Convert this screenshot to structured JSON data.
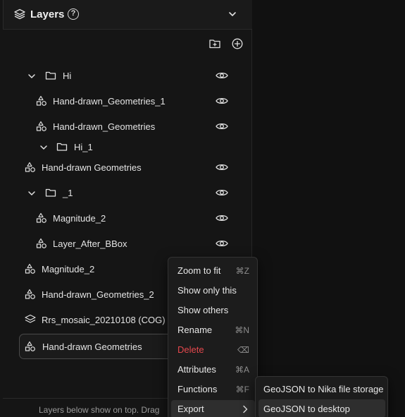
{
  "panel": {
    "title": "Layers",
    "help_icon": "?",
    "footer_text": "Layers below show on top. Drag"
  },
  "layers": [
    {
      "label": "Hi",
      "kind": "folder",
      "expanded": true,
      "visible": true
    },
    {
      "label": "Hand-drawn_Geometries_1",
      "kind": "geometry",
      "visible": true
    },
    {
      "label": "Hand-drawn_Geometries",
      "kind": "geometry",
      "visible": true
    },
    {
      "label": "Hi_1",
      "kind": "folder",
      "expanded": true
    },
    {
      "label": "Hand-drawn Geometries",
      "kind": "geometry",
      "visible": true
    },
    {
      "label": "_1",
      "kind": "folder",
      "expanded": true,
      "visible": true
    },
    {
      "label": "Magnitude_2",
      "kind": "geometry",
      "visible": true
    },
    {
      "label": "Layer_After_BBox",
      "kind": "geometry",
      "visible": true
    },
    {
      "label": "Magnitude_2",
      "kind": "geometry"
    },
    {
      "label": "Hand-drawn_Geometries_2",
      "kind": "geometry"
    },
    {
      "label": "Rrs_mosaic_20210108 (COG)",
      "kind": "raster"
    },
    {
      "label": "Hand-drawn Geometries",
      "kind": "geometry",
      "selected": true
    }
  ],
  "context_menu": {
    "items": [
      {
        "label": "Zoom to fit",
        "shortcut": "⌘Z"
      },
      {
        "label": "Show only this",
        "shortcut": ""
      },
      {
        "label": "Show others",
        "shortcut": ""
      },
      {
        "label": "Rename",
        "shortcut": "⌘N"
      },
      {
        "label": "Delete",
        "shortcut": "⌫",
        "danger": true
      },
      {
        "label": "Attributes",
        "shortcut": "⌘A"
      },
      {
        "label": "Functions",
        "shortcut": "⌘F"
      },
      {
        "label": "Export",
        "shortcut": "",
        "submenu": true,
        "active": true
      }
    ]
  },
  "export_submenu": {
    "items": [
      {
        "label": "GeoJSON to Nika file storage"
      },
      {
        "label": "GeoJSON to desktop",
        "active": true
      }
    ]
  },
  "colors": {
    "background": "#111111",
    "panel": "#151515",
    "text": "#e4e4e4",
    "danger": "#e5484d",
    "menu_hover": "#2e2e2e"
  }
}
